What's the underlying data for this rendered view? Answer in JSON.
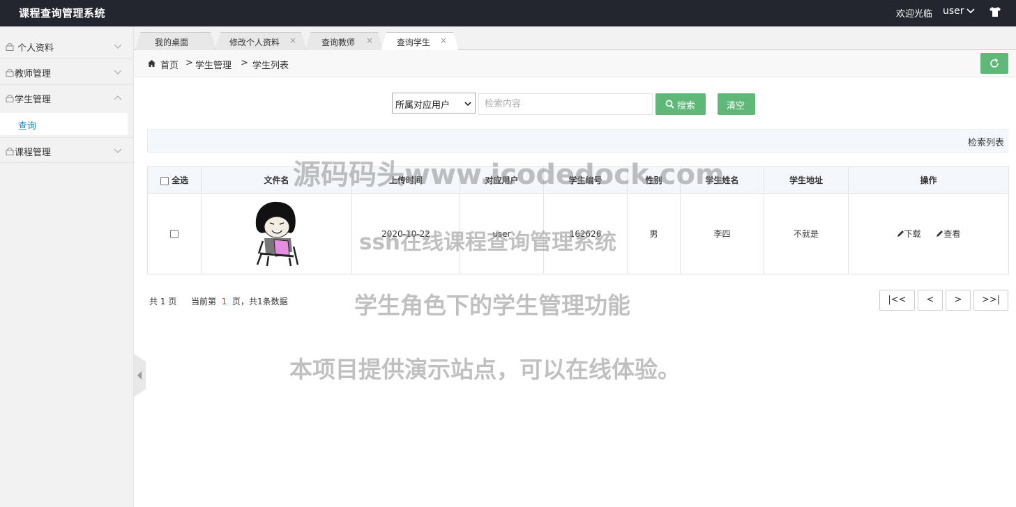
{
  "app": {
    "title": "课程查询管理系统"
  },
  "topbar": {
    "welcome": "欢迎光临",
    "username": "user"
  },
  "sidebar": {
    "items": [
      {
        "label": "个人资料"
      },
      {
        "label": "教师管理"
      },
      {
        "label": "学生管理"
      },
      {
        "label": "课程管理"
      }
    ],
    "sub_item": {
      "label": "查询"
    }
  },
  "tabs": [
    {
      "label": "我的桌面"
    },
    {
      "label": "修改个人资料",
      "close": "×"
    },
    {
      "label": "查询教师",
      "close": "×"
    },
    {
      "label": "查询学生",
      "close": "×"
    }
  ],
  "breadcrumb": {
    "home": "首页",
    "sep": ">",
    "level1": "学生管理",
    "level2": "学生列表"
  },
  "search": {
    "select_value": "所属对应用户",
    "placeholder": "检索内容",
    "search_label": "搜索",
    "clear_label": "清空"
  },
  "list_header": "检索列表",
  "table": {
    "select_all": "全选",
    "columns": [
      "文件名",
      "上传时间",
      "对应用户",
      "学生编号",
      "性别",
      "学生姓名",
      "学生地址",
      "操作"
    ],
    "rows": [
      {
        "upload_time": "2020-10-22",
        "user": "user",
        "student_no": "162626",
        "gender": "男",
        "name": "李四",
        "address": "不就是",
        "download": "下载",
        "view": "查看"
      }
    ]
  },
  "pagination": {
    "total_prefix": "共",
    "total_pages": "1",
    "total_suffix": "页",
    "current_prefix": "当前第",
    "current_page": "1",
    "current_suffix": "页，共1条数据",
    "first": "|<<",
    "prev": "<",
    "next": ">",
    "last": ">>|"
  },
  "watermark": {
    "line1": "源码码头www.icodedock.com",
    "line2": "ssh在线课程查询管理系统",
    "line3": "学生角色下的学生管理功能",
    "line4": "本项目提供演示站点，可以在线体验。"
  },
  "colors": {
    "topbar": "#23262e",
    "accent_green": "#5fb878",
    "link_blue": "#1e88c8",
    "current_page": "#e0301e"
  },
  "icons": [
    "chevron-down-icon",
    "tshirt-icon",
    "lock-icon",
    "home-icon",
    "refresh-icon",
    "search-icon",
    "edit-icon"
  ]
}
